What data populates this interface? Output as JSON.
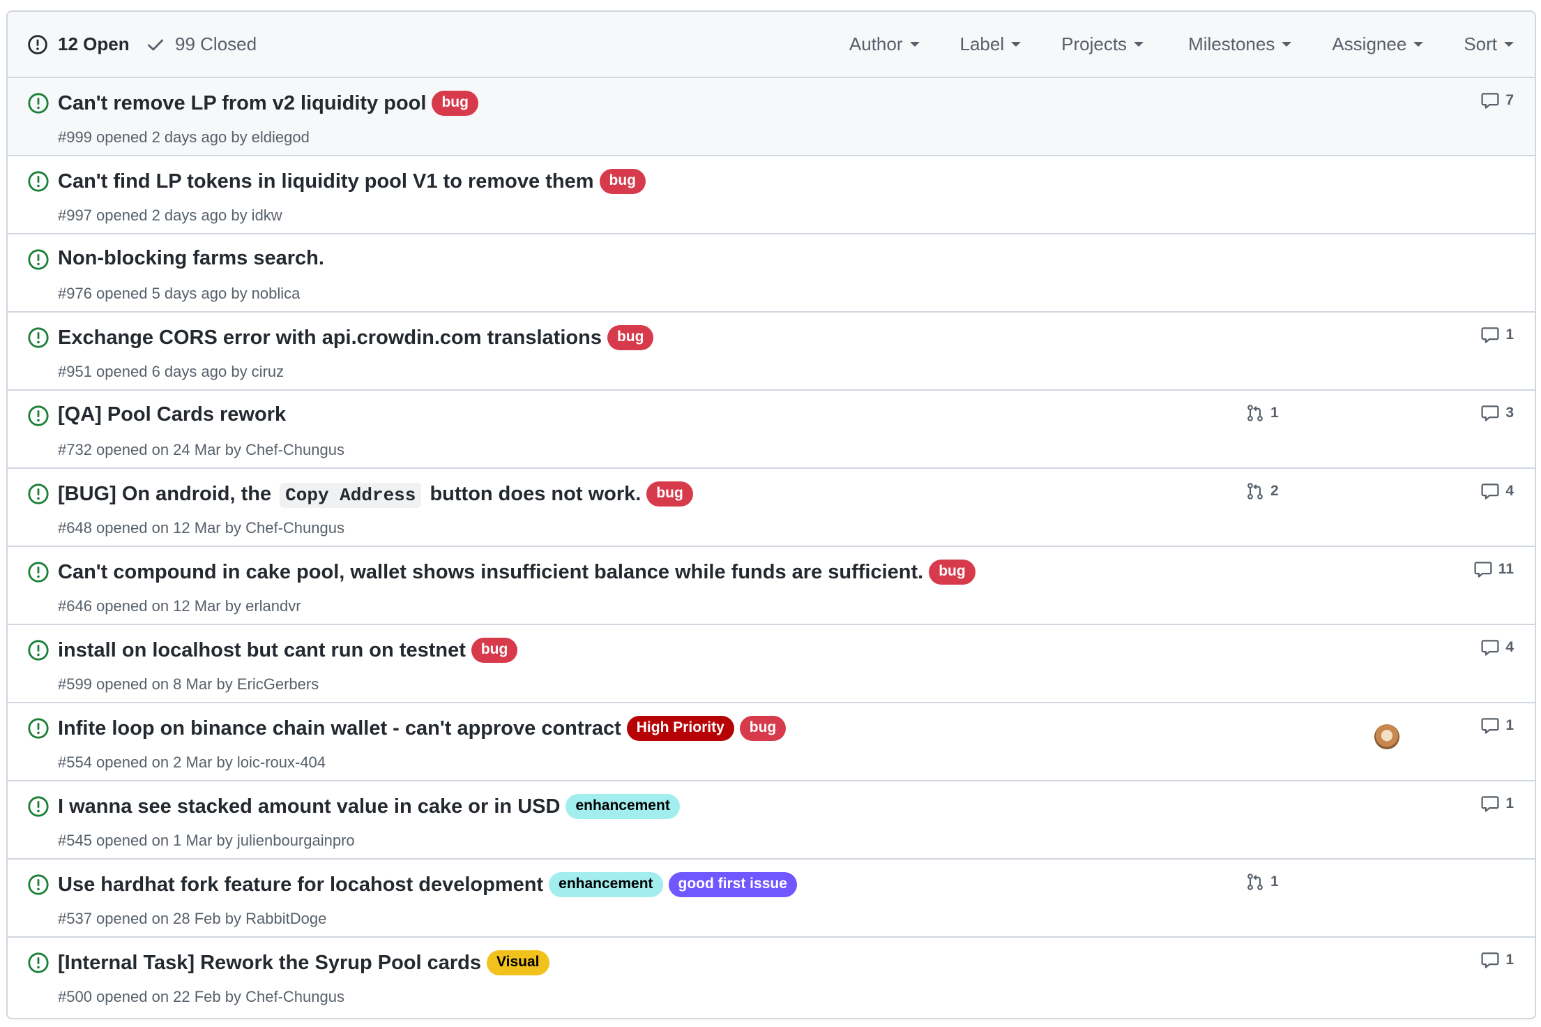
{
  "header": {
    "open_label": "12 Open",
    "closed_label": "99 Closed",
    "filters": [
      "Author",
      "Label",
      "Projects",
      "Milestones",
      "Assignee",
      "Sort"
    ]
  },
  "colors": {
    "open_icon": "#1a7f37",
    "bug": "#d73a4a",
    "high_priority": "#b60205",
    "enhancement": "#a2eeef",
    "good_first_issue": "#7057ff",
    "visual": "#f1c21b"
  },
  "issues": [
    {
      "title": "Can't remove LP from v2 liquidity pool",
      "meta": "#999 opened 2 days ago by eldiegod",
      "labels": [
        {
          "text": "bug"
        }
      ],
      "comments": "7",
      "prs": ""
    },
    {
      "title": "Can't find LP tokens in liquidity pool V1 to remove them",
      "meta": "#997 opened 2 days ago by idkw",
      "labels": [
        {
          "text": "bug"
        }
      ],
      "comments": "",
      "prs": ""
    },
    {
      "title": "Non-blocking farms search.",
      "meta": "#976 opened 5 days ago by noblica",
      "labels": [],
      "comments": "",
      "prs": ""
    },
    {
      "title": "Exchange CORS error with api.crowdin.com translations",
      "meta": "#951 opened 6 days ago by ciruz",
      "labels": [
        {
          "text": "bug"
        }
      ],
      "comments": "1",
      "prs": ""
    },
    {
      "title": "[QA] Pool Cards rework",
      "meta": "#732 opened on 24 Mar by Chef-Chungus",
      "labels": [],
      "comments": "3",
      "prs": "1"
    },
    {
      "title_before": "[BUG] On android, the",
      "title_code": "Copy Address",
      "title_after": "button does not work.",
      "meta": "#648 opened on 12 Mar by Chef-Chungus",
      "labels": [
        {
          "text": "bug"
        }
      ],
      "comments": "4",
      "prs": "2"
    },
    {
      "title": "Can't compound in cake pool, wallet shows insufficient balance while funds are sufficient.",
      "meta": "#646 opened on 12 Mar by erlandvr",
      "labels": [
        {
          "text": "bug"
        }
      ],
      "comments": "11",
      "prs": ""
    },
    {
      "title": "install on localhost but cant run on testnet",
      "meta": "#599 opened on 8 Mar by EricGerbers",
      "labels": [
        {
          "text": "bug"
        }
      ],
      "comments": "4",
      "prs": ""
    },
    {
      "title": "Infite loop on binance chain wallet - can't approve contract",
      "meta": "#554 opened on 2 Mar by loic-roux-404",
      "labels": [
        {
          "text": "High Priority"
        },
        {
          "text": "bug"
        }
      ],
      "comments": "1",
      "prs": "",
      "assignee": true
    },
    {
      "title": "I wanna see stacked amount value in cake or in USD",
      "meta": "#545 opened on 1 Mar by julienbourgainpro",
      "labels": [
        {
          "text": "enhancement"
        }
      ],
      "comments": "1",
      "prs": ""
    },
    {
      "title": "Use hardhat fork feature for locahost development",
      "meta": "#537 opened on 28 Feb by RabbitDoge",
      "labels": [
        {
          "text": "enhancement"
        },
        {
          "text": "good first issue"
        }
      ],
      "comments": "",
      "prs": "1"
    },
    {
      "title": "[Internal Task] Rework the Syrup Pool cards",
      "meta": "#500 opened on 22 Feb by Chef-Chungus",
      "labels": [
        {
          "text": "Visual"
        }
      ],
      "comments": "1",
      "prs": ""
    }
  ]
}
